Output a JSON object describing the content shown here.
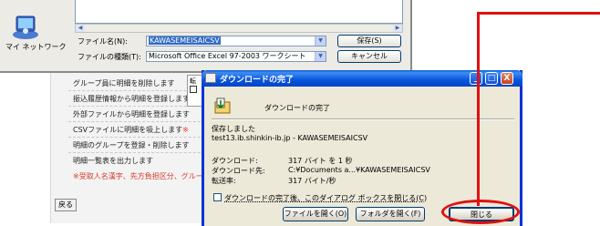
{
  "save_dialog": {
    "places_label": "マイ ネットワーク",
    "filename_label": "ファイル名(N):",
    "filename_value": "KAWASEMEISAICSV",
    "filetype_label": "ファイルの種類(T):",
    "filetype_value": "Microsoft Office Excel 97-2003 ワークシート",
    "save_button": "保存(S)",
    "cancel_button": "キャンセル"
  },
  "page": {
    "menu_items": [
      "グループ員に明細を削除します",
      "振込履歴情報から明細を登録します",
      "外部ファイルから明細を登録します",
      "CSVファイルに明細を吸上します",
      "明細のグループを登録・削除します",
      "明細一覧表を出力します"
    ],
    "csv_mark": "※",
    "note": "※受取人名漢字、先方負担区分、グループ",
    "back_button": "戻る",
    "mini_panel_text": "転"
  },
  "download_dialog": {
    "title": "ダウンロードの完了",
    "header_text": "ダウンロードの完了",
    "saved_label": "保存しました",
    "source": "test13.ib.shinkin-ib.jp - KAWASEMEISAICSV",
    "download_label": "ダウンロード:",
    "download_value": "317 バイト を 1 秒",
    "dest_label": "ダウンロード先:",
    "dest_value": "C:¥Documents a...¥KAWASEMEISAICSV",
    "rate_label": "転送率:",
    "rate_value": "317 バイト/秒",
    "checkbox_label": "ダウンロードの完了後、このダイアログ ボックスを閉じる(C)",
    "open_file_button": "ファイルを開く(O)",
    "open_folder_button": "フォルダを開く(F)",
    "close_button": "閉じる",
    "minimize_glyph": "_",
    "maximize_glyph": "□",
    "close_glyph": "X"
  }
}
